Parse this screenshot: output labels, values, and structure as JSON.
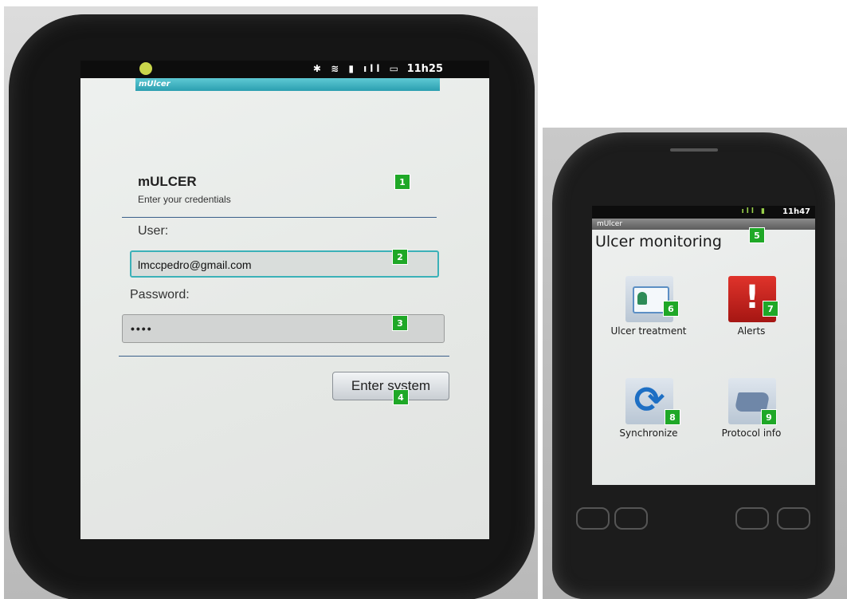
{
  "tablet": {
    "status_time": "11h25",
    "status_icons": "✱ ≋ ▮ ıll ▭",
    "app_bar_title": "mUlcer",
    "heading": "mULCER",
    "subheading": "Enter your credentials",
    "user_label": "User:",
    "user_value": "lmccpedro@gmail.com",
    "password_label": "Password:",
    "password_value": "••••",
    "enter_button": "Enter system"
  },
  "phone": {
    "status_time": "11h47",
    "status_icons": "ıll ▮",
    "app_bar_title": "mUlcer",
    "page_title": "Ulcer monitoring",
    "tiles": [
      {
        "label": "Ulcer treatment",
        "icon": "patient-card-icon"
      },
      {
        "label": "Alerts",
        "icon": "alert-icon"
      },
      {
        "label": "Synchronize",
        "icon": "sync-icon"
      },
      {
        "label": "Protocol info",
        "icon": "book-icon"
      }
    ]
  },
  "annotations": [
    "1",
    "2",
    "3",
    "4",
    "5",
    "6",
    "7",
    "8",
    "9"
  ],
  "colors": {
    "badge": "#1fa827",
    "tablet_app_bar": "#2b9fb0",
    "focus_border": "#3bb1b8",
    "alert_red": "#c7221c",
    "sync_blue": "#1e6fc4"
  }
}
